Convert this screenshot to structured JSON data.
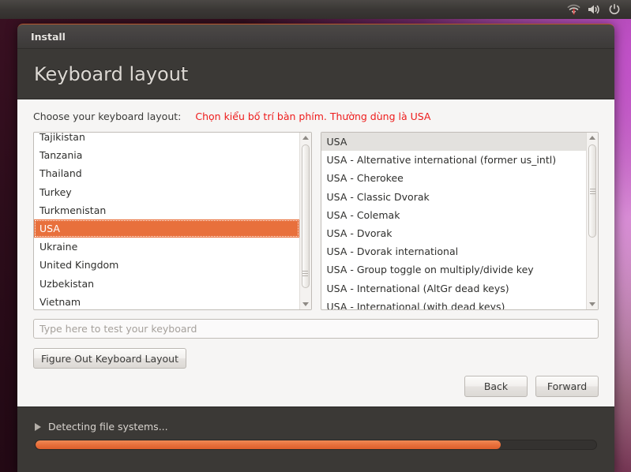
{
  "panel": {
    "icons": [
      {
        "name": "wifi-icon",
        "label": "Network (no connection)"
      },
      {
        "name": "volume-icon",
        "label": "Volume"
      },
      {
        "name": "power-icon",
        "label": "System menu"
      }
    ]
  },
  "window": {
    "title": "Install",
    "page_title": "Keyboard layout"
  },
  "content": {
    "choose_label": "Choose your keyboard layout:",
    "annotation": "Chọn kiểu bố trí bàn phím. Thường dùng là USA",
    "annotation_color": "#ee1c1c"
  },
  "country_list": {
    "selected": "USA",
    "selection_color": "#e8703c",
    "items": [
      "Tajikistan",
      "Tanzania",
      "Thailand",
      "Turkey",
      "Turkmenistan",
      "USA",
      "Ukraine",
      "United Kingdom",
      "Uzbekistan",
      "Vietnam"
    ]
  },
  "variant_list": {
    "selected": "USA",
    "selection_color": "#e3e1de",
    "items": [
      "USA",
      "USA - Alternative international (former us_intl)",
      "USA - Cherokee",
      "USA - Classic Dvorak",
      "USA - Colemak",
      "USA - Dvorak",
      "USA - Dvorak international",
      "USA - Group toggle on multiply/divide key",
      "USA - International (AltGr dead keys)",
      "USA - International (with dead keys)"
    ]
  },
  "test_field": {
    "value": "",
    "placeholder": "Type here to test your keyboard"
  },
  "buttons": {
    "figure_out": "Figure Out Keyboard Layout",
    "back": "Back",
    "forward": "Forward"
  },
  "status": {
    "text": "Detecting file systems...",
    "progress_percent": 83,
    "progress_color": "#e8703c"
  }
}
